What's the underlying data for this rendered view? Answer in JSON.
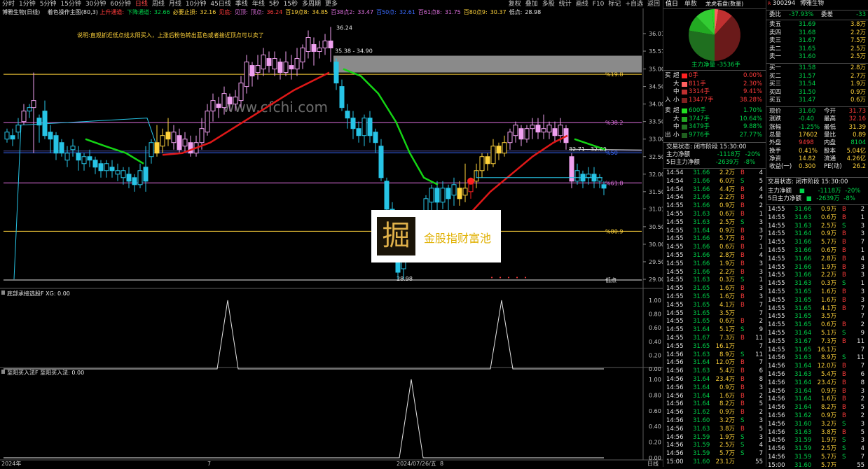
{
  "toolbar": {
    "periods": [
      "分时",
      "1分钟",
      "5分钟",
      "15分钟",
      "30分钟",
      "60分钟",
      "日线",
      "周线",
      "月线",
      "10分钟",
      "45日线",
      "季线",
      "年线",
      "5秒",
      "15秒",
      "多周期",
      "更多"
    ],
    "active_period": "日线",
    "tools": [
      "复权",
      "叠加",
      "多股",
      "统计",
      "画线",
      "F10",
      "标记",
      "+自选",
      "返回"
    ]
  },
  "main": {
    "stock_label": "博雅生物(日线)",
    "indicator_label": "着色操作主图(80,3)",
    "legend": [
      {
        "text": "上升通道:",
        "color": "#ff3b3b"
      },
      {
        "text": "下降通道:",
        "color": "#00d24a"
      },
      {
        "text": "32.66",
        "color": "#00d24a"
      },
      {
        "text": "必要止损:",
        "color": "#ffd33b"
      },
      {
        "text": "32.16",
        "color": "#ffd33b"
      },
      {
        "text": "见底:",
        "color": "#ff3b3b"
      },
      {
        "text": "见顶:",
        "color": "#e070e0"
      },
      {
        "text": "顶点:",
        "color": "#e070e0"
      },
      {
        "text": "36.24",
        "color": "#ff3b3b"
      },
      {
        "text": "百19点8:",
        "color": "#ffd33b"
      },
      {
        "text": "34.85",
        "color": "#ffd33b"
      },
      {
        "text": "百38点2:",
        "color": "#e070e0"
      },
      {
        "text": "33.47",
        "color": "#e070e0"
      },
      {
        "text": "百50点:",
        "color": "#3a6bff"
      },
      {
        "text": "32.61",
        "color": "#3a6bff"
      },
      {
        "text": "百61点8:",
        "color": "#e070e0"
      },
      {
        "text": "31.75",
        "color": "#e070e0"
      },
      {
        "text": "百80点9:",
        "color": "#ffd33b"
      },
      {
        "text": "30.37",
        "color": "#ffd33b"
      },
      {
        "text": "低点:",
        "color": "#e6e6e6"
      },
      {
        "text": "28.98",
        "color": "#e6e6e6"
      }
    ],
    "note": "说明:直观抓近低点线太阳买入，上涨后粉色转出蓝色或者接近顶点可以卖了",
    "box_label": "35.38 - 34.90",
    "top_label": "36.24",
    "low_label": "28.98",
    "trend_label": "32.71 - 32.69",
    "fib_labels": {
      "f19": "%19.8",
      "f38": "%38.2",
      "f50": "%50",
      "f61": "%61.8",
      "f80": "%80.9",
      "low": "低点"
    },
    "price_axis": [
      "36.01",
      "35.51",
      "35.00",
      "34.50",
      "34.00",
      "33.50",
      "33.00",
      "32.50",
      "32.00",
      "31.50",
      "31.01",
      "30.50",
      "30.00",
      "29.50",
      "29.00"
    ],
    "watermark": "www.cfchi.com",
    "ad_text": "金股指财富池",
    "ad_logo_char": "掘",
    "sub1_label": "底部承接选股F XG: 0.00",
    "sub1_axis": [
      "1.00",
      "0.80",
      "0.60",
      "0.40",
      "0.20",
      "0.00"
    ],
    "sub2_label": "至阳买入法F 至阳买入法: 0.00",
    "sub2_axis": [
      "1.00",
      "0.80",
      "0.60",
      "0.40",
      "0.20",
      "0.00"
    ],
    "date_axis": [
      "2024年",
      "7",
      "2024/07/26/五",
      "8"
    ],
    "date_right": "日线"
  },
  "right": {
    "tabs": [
      "值日",
      "单数"
    ],
    "big_money_label": "龙虎看盘(数量)",
    "pie_caption": "主力净量 -3536手",
    "flow_buy_head": "买入",
    "flow_sell_head": "卖出",
    "flow_rows": [
      {
        "side": "买",
        "size": "超",
        "vol": "0手",
        "pct": "0.00%",
        "color": "#ff2222"
      },
      {
        "side": "",
        "size": "大",
        "vol": "811手",
        "pct": "2.30%",
        "color": "#ff6060"
      },
      {
        "side": "",
        "size": "中",
        "vol": "3314手",
        "pct": "9.41%",
        "color": "#c03030"
      },
      {
        "side": "入",
        "size": "小",
        "vol": "13477手",
        "pct": "38.28%",
        "color": "#802020"
      },
      {
        "side": "卖",
        "size": "超",
        "vol": "600手",
        "pct": "1.70%",
        "color": "#22dd22"
      },
      {
        "side": "",
        "size": "大",
        "vol": "3747手",
        "pct": "10.64%",
        "color": "#22aa22"
      },
      {
        "side": "",
        "size": "中",
        "vol": "3479手",
        "pct": "9.88%",
        "color": "#227722"
      },
      {
        "side": "出",
        "size": "小",
        "vol": "9776手",
        "pct": "27.77%",
        "color": "#1f5f1f"
      }
    ],
    "status": "交易状态: 闭市阶段 15:30:00",
    "net_main": {
      "label": "主力净额",
      "value": "-1118万",
      "pct": "-20%"
    },
    "net5": {
      "label": "5日主力净额",
      "value": "-2639万",
      "pct": "-8%"
    },
    "stock_code": "300294",
    "stock_name": "博雅生物",
    "weibi": {
      "label": "委比",
      "value": "-37.93%",
      "label2": "委差",
      "value2": "-33"
    },
    "asks": [
      {
        "name": "卖五",
        "price": "31.69",
        "vol": "3.8万"
      },
      {
        "name": "卖四",
        "price": "31.68",
        "vol": "2.2万"
      },
      {
        "name": "卖三",
        "price": "31.67",
        "vol": "7.5万"
      },
      {
        "name": "卖二",
        "price": "31.65",
        "vol": "2.5万"
      },
      {
        "name": "卖一",
        "price": "31.60",
        "vol": "2.5万"
      }
    ],
    "bids": [
      {
        "name": "买一",
        "price": "31.58",
        "vol": "2.8万"
      },
      {
        "name": "买二",
        "price": "31.57",
        "vol": "2.7万"
      },
      {
        "name": "买三",
        "price": "31.54",
        "vol": "1.9万"
      },
      {
        "name": "买四",
        "price": "31.50",
        "vol": "0.9万"
      },
      {
        "name": "买五",
        "price": "31.47",
        "vol": "0.6万"
      }
    ],
    "quote": [
      [
        "现价",
        "31.60",
        "今开",
        "31.73"
      ],
      [
        "涨跌",
        "-0.40",
        "最高",
        "32.16"
      ],
      [
        "涨幅",
        "-1.25%",
        "最低",
        "31.39"
      ],
      [
        "总量",
        "17602",
        "量比",
        "0.89"
      ],
      [
        "外盘",
        "9498",
        "内盘",
        "8104"
      ],
      [
        "换手",
        "0.41%",
        "股本",
        "5.04亿"
      ],
      [
        "净资",
        "14.82",
        "流通",
        "4.26亿"
      ],
      [
        "收益(一)",
        "0.300",
        "PE(动)",
        "26.2"
      ]
    ],
    "net_main2": {
      "label": "主力净额",
      "value": "-1118万",
      "pct": "-20%"
    },
    "net5_2": {
      "label": "5日主力净额",
      "value": "-2639万",
      "pct": "-8%"
    },
    "status2": "交易状态: 闭市阶段 15:30:00",
    "ticks_left": [
      [
        "14:54",
        "31.66",
        "2.2万",
        "B",
        "4"
      ],
      [
        "14:54",
        "31.66",
        "6.0万",
        "S",
        "5"
      ],
      [
        "14:54",
        "31.66",
        "4.4万",
        "B",
        "4"
      ],
      [
        "14:54",
        "31.66",
        "2.2万",
        "B",
        "4"
      ],
      [
        "14:55",
        "31.66",
        "0.9万",
        "B",
        "2"
      ],
      [
        "14:55",
        "31.63",
        "0.6万",
        "B",
        "1"
      ],
      [
        "14:55",
        "31.63",
        "2.5万",
        "S",
        "3"
      ],
      [
        "14:55",
        "31.64",
        "0.9万",
        "B",
        "3"
      ],
      [
        "14:55",
        "31.66",
        "5.7万",
        "B",
        "7"
      ],
      [
        "14:55",
        "31.66",
        "0.6万",
        "B",
        "1"
      ],
      [
        "14:55",
        "31.66",
        "2.8万",
        "B",
        "4"
      ],
      [
        "14:55",
        "31.66",
        "1.9万",
        "B",
        "3"
      ],
      [
        "14:55",
        "31.66",
        "2.2万",
        "B",
        "3"
      ],
      [
        "14:55",
        "31.63",
        "0.3万",
        "S",
        "1"
      ],
      [
        "14:55",
        "31.65",
        "1.6万",
        "B",
        "3"
      ],
      [
        "14:55",
        "31.65",
        "1.6万",
        "B",
        "3"
      ],
      [
        "14:55",
        "31.65",
        "4.1万",
        "B",
        "7"
      ],
      [
        "14:55",
        "31.65",
        "3.5万",
        "",
        "7"
      ],
      [
        "14:55",
        "31.65",
        "0.6万",
        "B",
        "2"
      ],
      [
        "14:55",
        "31.64",
        "5.1万",
        "S",
        "9"
      ],
      [
        "14:55",
        "31.67",
        "7.3万",
        "B",
        "11"
      ],
      [
        "14:55",
        "31.65",
        "16.1万",
        "",
        "7"
      ],
      [
        "14:56",
        "31.63",
        "8.9万",
        "S",
        "11"
      ],
      [
        "14:56",
        "31.64",
        "12.0万",
        "B",
        "7"
      ],
      [
        "14:56",
        "31.63",
        "5.4万",
        "B",
        "6"
      ],
      [
        "14:56",
        "31.64",
        "23.4万",
        "B",
        "8"
      ],
      [
        "14:56",
        "31.64",
        "0.9万",
        "B",
        "3"
      ],
      [
        "14:56",
        "31.64",
        "1.6万",
        "B",
        "2"
      ],
      [
        "14:56",
        "31.64",
        "8.2万",
        "B",
        "5"
      ],
      [
        "14:56",
        "31.62",
        "0.9万",
        "B",
        "2"
      ],
      [
        "14:56",
        "31.60",
        "3.2万",
        "S",
        "3"
      ],
      [
        "14:56",
        "31.63",
        "3.8万",
        "B",
        "5"
      ],
      [
        "14:56",
        "31.59",
        "1.9万",
        "S",
        "3"
      ],
      [
        "14:56",
        "31.59",
        "2.5万",
        "S",
        "4"
      ],
      [
        "14:56",
        "31.59",
        "5.7万",
        "S",
        "7"
      ],
      [
        "15:00",
        "31.60",
        "23.1万",
        "",
        "55"
      ]
    ],
    "ticks_right": [
      [
        "14:55",
        "31.66",
        "0.9万",
        "B",
        "2"
      ],
      [
        "14:55",
        "31.63",
        "0.6万",
        "B",
        "1"
      ],
      [
        "14:55",
        "31.63",
        "2.5万",
        "S",
        "3"
      ],
      [
        "14:55",
        "31.64",
        "0.9万",
        "B",
        "3"
      ],
      [
        "14:55",
        "31.66",
        "5.7万",
        "B",
        "7"
      ],
      [
        "14:55",
        "31.66",
        "0.6万",
        "B",
        "1"
      ],
      [
        "14:55",
        "31.66",
        "2.8万",
        "B",
        "4"
      ],
      [
        "14:55",
        "31.66",
        "1.9万",
        "B",
        "3"
      ],
      [
        "14:55",
        "31.66",
        "2.2万",
        "B",
        "3"
      ],
      [
        "14:55",
        "31.63",
        "0.3万",
        "S",
        "1"
      ],
      [
        "14:55",
        "31.65",
        "1.6万",
        "B",
        "3"
      ],
      [
        "14:55",
        "31.65",
        "1.6万",
        "B",
        "3"
      ],
      [
        "14:55",
        "31.65",
        "4.1万",
        "B",
        "7"
      ],
      [
        "14:55",
        "31.65",
        "3.5万",
        "",
        "7"
      ],
      [
        "14:55",
        "31.65",
        "0.6万",
        "B",
        "2"
      ],
      [
        "14:55",
        "31.64",
        "5.1万",
        "S",
        "9"
      ],
      [
        "14:55",
        "31.67",
        "7.3万",
        "B",
        "11"
      ],
      [
        "14:55",
        "31.65",
        "16.1万",
        "",
        "7"
      ],
      [
        "14:56",
        "31.63",
        "8.9万",
        "S",
        "11"
      ],
      [
        "14:56",
        "31.64",
        "12.0万",
        "B",
        "7"
      ],
      [
        "14:56",
        "31.63",
        "5.4万",
        "B",
        "6"
      ],
      [
        "14:56",
        "31.64",
        "23.4万",
        "B",
        "8"
      ],
      [
        "14:56",
        "31.64",
        "0.9万",
        "B",
        "3"
      ],
      [
        "14:56",
        "31.64",
        "1.6万",
        "B",
        "2"
      ],
      [
        "14:56",
        "31.64",
        "8.2万",
        "B",
        "5"
      ],
      [
        "14:56",
        "31.62",
        "0.9万",
        "B",
        "2"
      ],
      [
        "14:56",
        "31.60",
        "3.2万",
        "S",
        "3"
      ],
      [
        "14:56",
        "31.63",
        "3.8万",
        "B",
        "5"
      ],
      [
        "14:56",
        "31.59",
        "1.9万",
        "S",
        "3"
      ],
      [
        "14:56",
        "31.59",
        "2.5万",
        "S",
        "4"
      ],
      [
        "14:56",
        "31.59",
        "5.7万",
        "S",
        "7"
      ],
      [
        "15:00",
        "31.60",
        "5.7万",
        "",
        "55"
      ]
    ]
  },
  "colors": {
    "up": "#ff3b3b",
    "down": "#00d24a",
    "pink": "#e070e0",
    "cyan": "#27c4e6",
    "yellow": "#ffd33b",
    "blue": "#3a6bff"
  }
}
